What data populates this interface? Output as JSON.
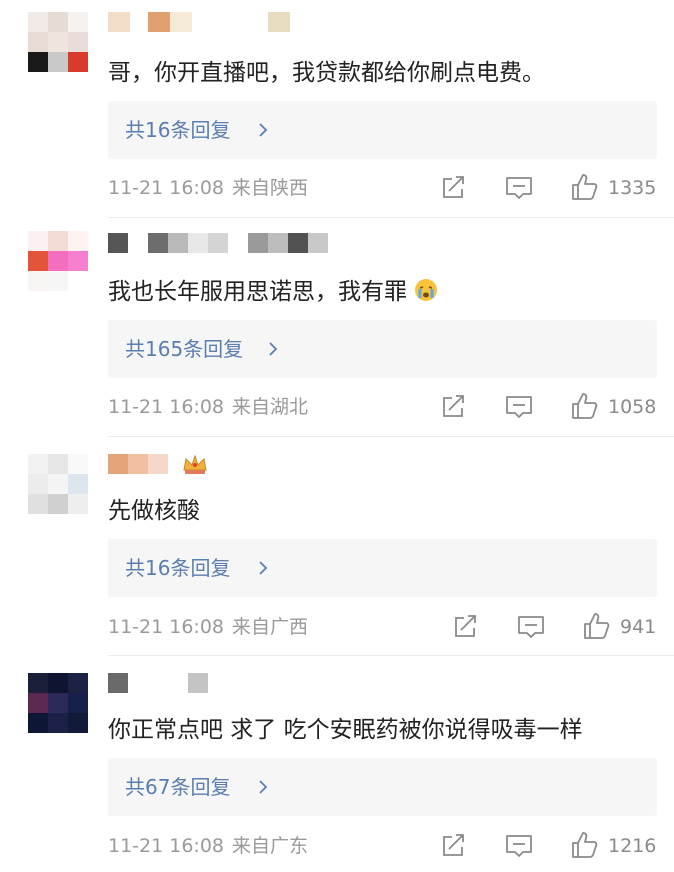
{
  "comments": [
    {
      "text": "哥，你开直播吧，我贷款都给你刷点电费。",
      "replies": "共16条回复",
      "time": "11-21 16:08",
      "location": "来自陕西",
      "likes": "1335"
    },
    {
      "text": "我也长年服用思诺思，我有罪",
      "emoji": "crying-face-icon",
      "replies": "共165条回复",
      "time": "11-21 16:08",
      "location": "来自湖北",
      "likes": "1058"
    },
    {
      "text": "先做核酸",
      "badge": "crown-icon",
      "replies": "共16条回复",
      "time": "11-21 16:08",
      "location": "来自广西",
      "likes": "941"
    },
    {
      "text": "你正常点吧 求了 吃个安眠药被你说得吸毒一样",
      "replies": "共67条回复",
      "time": "11-21 16:08",
      "location": "来自广东",
      "likes": "1216"
    }
  ],
  "icons": {
    "share": "share-icon",
    "comment": "comment-icon",
    "like": "thumbs-up-icon",
    "chevron": "chevron-right-icon"
  },
  "colors": {
    "reply_link": "#5b7db0",
    "meta": "#9a9a9a",
    "panel_bg": "#f6f6f6"
  }
}
